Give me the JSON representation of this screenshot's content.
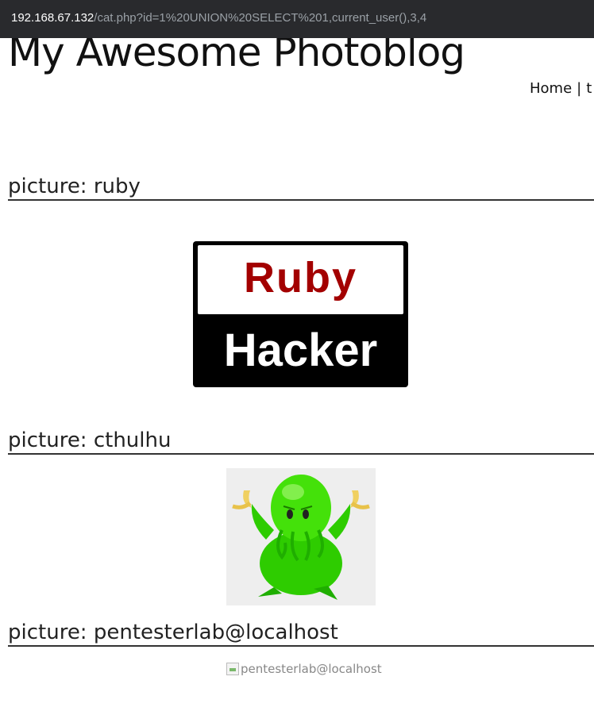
{
  "browser": {
    "url_host": "192.168.67.132",
    "url_path": "/cat.php?id=1%20UNION%20SELECT%201,current_user(),3,4"
  },
  "site": {
    "title": "My Awesome Photoblog"
  },
  "nav": {
    "home": "Home",
    "separator": "|",
    "next_partial": "t"
  },
  "pictures": [
    {
      "heading": "picture: ruby",
      "image": {
        "line1": "Ruby",
        "line2": "Hacker",
        "colors": {
          "ruby": "#a30000",
          "background": "#000000"
        }
      }
    },
    {
      "heading": "picture: cthulhu",
      "image": {
        "description_icon": "cthulhu-plush-icon",
        "colors": {
          "body": "#33dd00"
        }
      }
    },
    {
      "heading": "picture: pentesterlab@localhost",
      "image": {
        "alt": "pentesterlab@localhost",
        "broken": true
      }
    }
  ]
}
